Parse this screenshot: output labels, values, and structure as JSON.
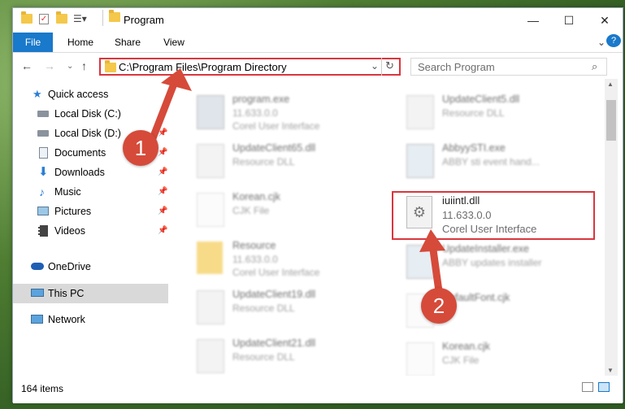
{
  "window": {
    "title": "Program"
  },
  "ribbon": {
    "tabs": [
      "File",
      "Home",
      "Share",
      "View"
    ]
  },
  "address": {
    "path": "C:\\Program Files\\Program Directory"
  },
  "search": {
    "placeholder": "Search Program"
  },
  "nav": {
    "items": [
      {
        "label": "Quick access",
        "icon": "star-icon"
      },
      {
        "label": "Local Disk (C:)",
        "icon": "drive-icon",
        "pinned": true
      },
      {
        "label": "Local Disk (D:)",
        "icon": "drive-icon",
        "pinned": true
      },
      {
        "label": "Documents",
        "icon": "documents-icon",
        "pinned": true
      },
      {
        "label": "Downloads",
        "icon": "download-icon",
        "pinned": true
      },
      {
        "label": "Music",
        "icon": "music-icon",
        "pinned": true
      },
      {
        "label": "Pictures",
        "icon": "pictures-icon",
        "pinned": true
      },
      {
        "label": "Videos",
        "icon": "videos-icon",
        "pinned": true
      },
      {
        "label": "OneDrive",
        "icon": "cloud-icon"
      },
      {
        "label": "This PC",
        "icon": "pc-icon",
        "selected": true
      },
      {
        "label": "Network",
        "icon": "network-icon"
      }
    ]
  },
  "files": {
    "left": [
      {
        "name": "program.exe",
        "line1": "11.633.0.0",
        "line2": "Corel User Interface"
      },
      {
        "name": "UpdateClient65.dll",
        "line1": "Resource DLL"
      },
      {
        "name": "Korean.cjk",
        "line1": "CJK File"
      },
      {
        "name": "Resource",
        "line1": "11.633.0.0",
        "line2": "Corel User Interface"
      },
      {
        "name": "UpdateClient19.dll",
        "line1": "Resource DLL"
      },
      {
        "name": "UpdateClient21.dll",
        "line1": "Resource DLL"
      }
    ],
    "right": [
      {
        "name": "UpdateClient5.dll",
        "line1": "Resource DLL"
      },
      {
        "name": "AbbyySTI.exe",
        "line1": "ABBY sti event hand..."
      },
      {
        "name": "iuiintl.dll",
        "line1": "11.633.0.0",
        "line2": "Corel User Interface"
      },
      {
        "name": "UpdateInstaller.exe",
        "line1": "ABBY updates installer"
      },
      {
        "name": "DefaultFont.cjk",
        "line1": ""
      },
      {
        "name": "Korean.cjk",
        "line1": "CJK File"
      }
    ]
  },
  "status": {
    "count": "164 items"
  },
  "annotations": {
    "step1": "1",
    "step2": "2"
  },
  "colors": {
    "accent": "#1979ca",
    "highlight": "#d9363e",
    "badge": "#d64a3a"
  }
}
